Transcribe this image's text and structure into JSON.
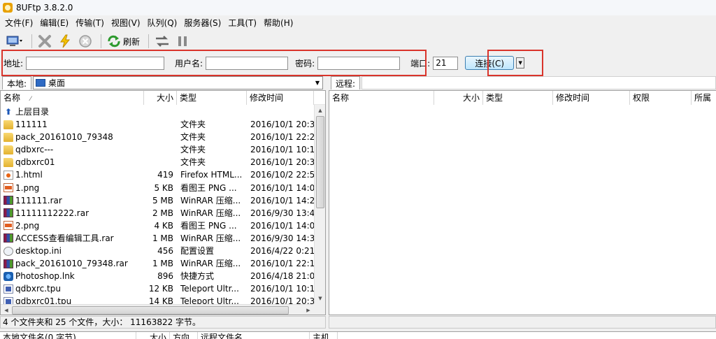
{
  "window": {
    "title": "8UFtp 3.8.2.0"
  },
  "menu": [
    "文件(F)",
    "编辑(E)",
    "传输(T)",
    "视图(V)",
    "队列(Q)",
    "服务器(S)",
    "工具(T)",
    "帮助(H)"
  ],
  "toolbar": {
    "refresh_label": "刷新"
  },
  "connection": {
    "address_label": "地址:",
    "address_value": "",
    "user_label": "用户名:",
    "user_value": "",
    "password_label": "密码:",
    "password_value": "",
    "port_label": "端口:",
    "port_value": "21",
    "connect_label": "连接(C)"
  },
  "local": {
    "tag": "本地:",
    "path": "桌面",
    "columns": {
      "name": "名称",
      "size": "大小",
      "type": "类型",
      "modified": "修改时间"
    },
    "files": [
      {
        "icon": "up",
        "name": "上层目录",
        "size": "",
        "type": "",
        "modified": ""
      },
      {
        "icon": "folder",
        "name": "111111",
        "size": "",
        "type": "文件夹",
        "modified": "2016/10/1 20:3"
      },
      {
        "icon": "folder",
        "name": "pack_20161010_79348",
        "size": "",
        "type": "文件夹",
        "modified": "2016/10/1 22:2"
      },
      {
        "icon": "folder",
        "name": "qdbxrc---",
        "size": "",
        "type": "文件夹",
        "modified": "2016/10/1 10:1"
      },
      {
        "icon": "folder",
        "name": "qdbxrc01",
        "size": "",
        "type": "文件夹",
        "modified": "2016/10/1 20:3"
      },
      {
        "icon": "html",
        "name": "1.html",
        "size": "419",
        "type": "Firefox HTML...",
        "modified": "2016/10/2 22:5"
      },
      {
        "icon": "png",
        "name": "1.png",
        "size": "5 KB",
        "type": "看图王 PNG ...",
        "modified": "2016/10/1 14:0"
      },
      {
        "icon": "rar",
        "name": "111111.rar",
        "size": "5 MB",
        "type": "WinRAR 压缩...",
        "modified": "2016/10/1 14:2"
      },
      {
        "icon": "rar",
        "name": "11111112222.rar",
        "size": "2 MB",
        "type": "WinRAR 压缩...",
        "modified": "2016/9/30 13:4"
      },
      {
        "icon": "png",
        "name": "2.png",
        "size": "4 KB",
        "type": "看图王 PNG ...",
        "modified": "2016/10/1 14:0"
      },
      {
        "icon": "rar",
        "name": "ACCESS查看编辑工具.rar",
        "size": "1 MB",
        "type": "WinRAR 压缩...",
        "modified": "2016/9/30 14:3"
      },
      {
        "icon": "ini",
        "name": "desktop.ini",
        "size": "456",
        "type": "配置设置",
        "modified": "2016/4/22 0:21"
      },
      {
        "icon": "rar",
        "name": "pack_20161010_79348.rar",
        "size": "1 MB",
        "type": "WinRAR 压缩...",
        "modified": "2016/10/1 22:1"
      },
      {
        "icon": "lnk",
        "name": "Photoshop.lnk",
        "size": "896",
        "type": "快捷方式",
        "modified": "2016/4/18 21:0"
      },
      {
        "icon": "tpu",
        "name": "qdbxrc.tpu",
        "size": "12 KB",
        "type": "Teleport Ultr...",
        "modified": "2016/10/1 10:1"
      },
      {
        "icon": "tpu",
        "name": "qdbxrc01.tpu",
        "size": "14 KB",
        "type": "Teleport Ultr...",
        "modified": "2016/10/1 20:3"
      }
    ],
    "status": "4 个文件夹和 25 个文件，大小： 11163822 字节。"
  },
  "remote": {
    "tag": "远程:",
    "path": "",
    "columns": {
      "name": "名称",
      "size": "大小",
      "type": "类型",
      "modified": "修改时间",
      "perm": "权限",
      "owner": "所属"
    }
  },
  "queue": {
    "columns": {
      "local": "本地文件名(0 字节)",
      "size": "大小",
      "dir": "方向",
      "remote": "远程文件名",
      "host": "主机"
    }
  },
  "colors": {
    "highlight_box": "#d9342b",
    "folder": "#e3b12f"
  }
}
